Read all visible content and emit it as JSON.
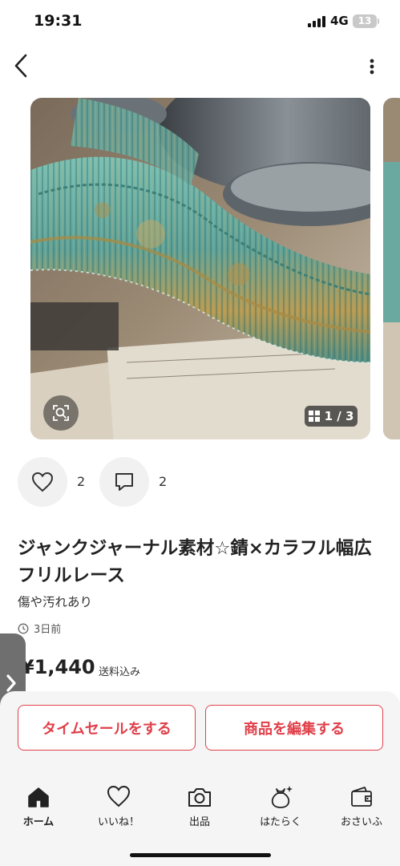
{
  "status_bar": {
    "time": "19:31",
    "network": "4G",
    "battery": "13"
  },
  "gallery": {
    "counter": "1 / 3"
  },
  "actions": {
    "like_count": "2",
    "comment_count": "2"
  },
  "item": {
    "title": "ジャンクジャーナル素材☆錆×カラフル幅広フリルレース",
    "condition": "傷や汚れあり",
    "posted": "3日前",
    "price": "¥1,440",
    "price_note": "送料込み"
  },
  "buttons": {
    "time_sale": "タイムセールをする",
    "edit_item": "商品を編集する"
  },
  "tabbar": {
    "items": [
      {
        "label": "ホーム"
      },
      {
        "label": "いいね！"
      },
      {
        "label": "出品"
      },
      {
        "label": "はたらく"
      },
      {
        "label": "おさいふ"
      }
    ]
  },
  "colors": {
    "accent": "#e0404a",
    "lace": "#5fa39a"
  }
}
